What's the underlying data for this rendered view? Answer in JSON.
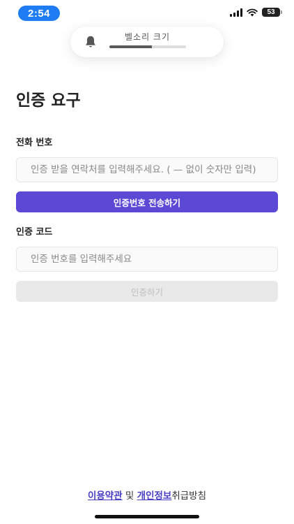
{
  "status_bar": {
    "time": "2:54",
    "battery": "53"
  },
  "volume_hud": {
    "label": "벨소리 크기",
    "level": 0.55
  },
  "page": {
    "title": "인증 요구"
  },
  "phone": {
    "label": "전화 번호",
    "placeholder": "인증 받을 연락처를 입력해주세요. ( — 없이 숫자만 입력)",
    "button": "인증번호 전송하기"
  },
  "code": {
    "label": "인증 코드",
    "placeholder": "인증 번호를 입력해주세요",
    "button": "인증하기"
  },
  "footer": {
    "terms": "이용약관",
    "and": " 및 ",
    "privacy": "개인정보",
    "policy_suffix": "취급방침"
  },
  "colors": {
    "primary": "#5b48d4",
    "link": "#4a3fc4",
    "time_pill": "#1f7cf2"
  }
}
